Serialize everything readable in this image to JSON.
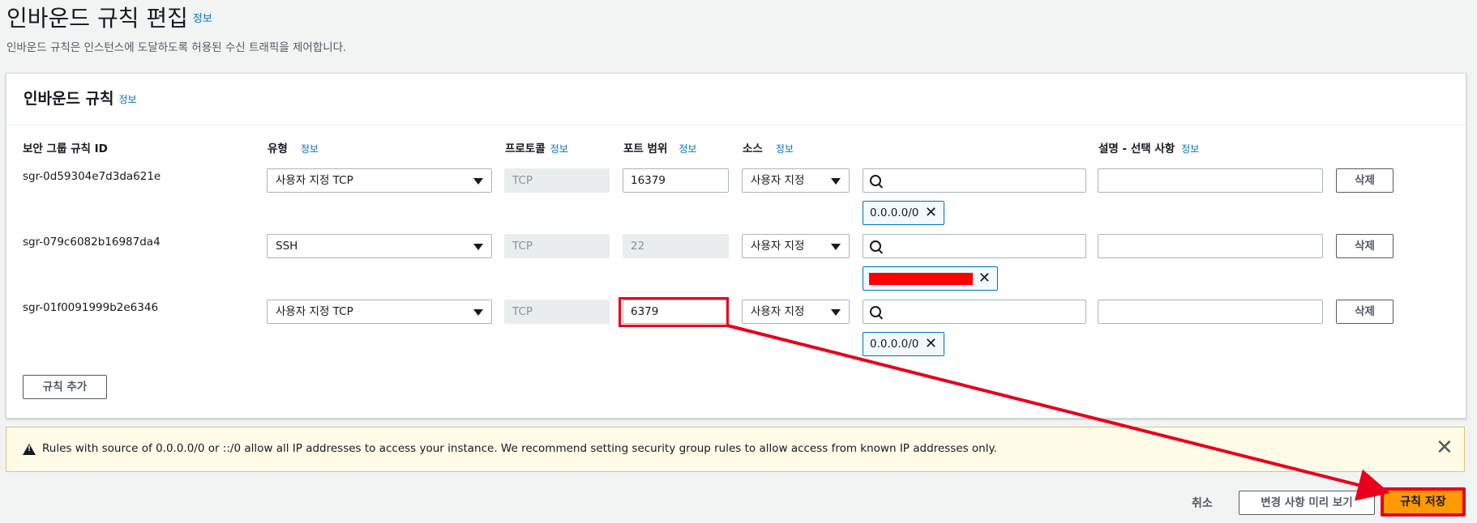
{
  "page": {
    "title": "인바운드 규칙 편집",
    "info": "정보",
    "description": "인바운드 규칙은 인스턴스에 도달하도록 허용된 수신 트래픽을 제어합니다."
  },
  "panel": {
    "title": "인바운드 규칙",
    "info": "정보",
    "columns": {
      "rule_id": "보안 그룹 규칙 ID",
      "type": "유형",
      "protocol": "프로토콜",
      "port_range": "포트 범위",
      "source": "소스",
      "description": "설명 - 선택 사항",
      "info": "정보"
    },
    "rules": [
      {
        "id": "sgr-0d59304e7d3da621e",
        "type": "사용자 지정 TCP",
        "protocol": "TCP",
        "port": "16379",
        "source_mode": "사용자 지정",
        "token": "0.0.0.0/0",
        "delete": "삭제"
      },
      {
        "id": "sgr-079c6082b16987da4",
        "type": "SSH",
        "protocol": "TCP",
        "port": "22",
        "source_mode": "사용자 지정",
        "token": "",
        "delete": "삭제"
      },
      {
        "id": "sgr-01f0091999b2e6346",
        "type": "사용자 지정 TCP",
        "protocol": "TCP",
        "port": "6379",
        "source_mode": "사용자 지정",
        "token": "0.0.0.0/0",
        "delete": "삭제"
      }
    ],
    "add_rule": "규칙 추가"
  },
  "warning": {
    "text": "Rules with source of 0.0.0.0/0 or ::/0 allow all IP addresses to access your instance. We recommend setting security group rules to allow access from known IP addresses only.",
    "close": "✕"
  },
  "footer": {
    "cancel": "취소",
    "preview": "변경 사항 미리 보기",
    "save": "규칙 저장"
  },
  "colors": {
    "primary": "#ff9900",
    "annotation": "#e8001a",
    "link": "#0073bb"
  }
}
